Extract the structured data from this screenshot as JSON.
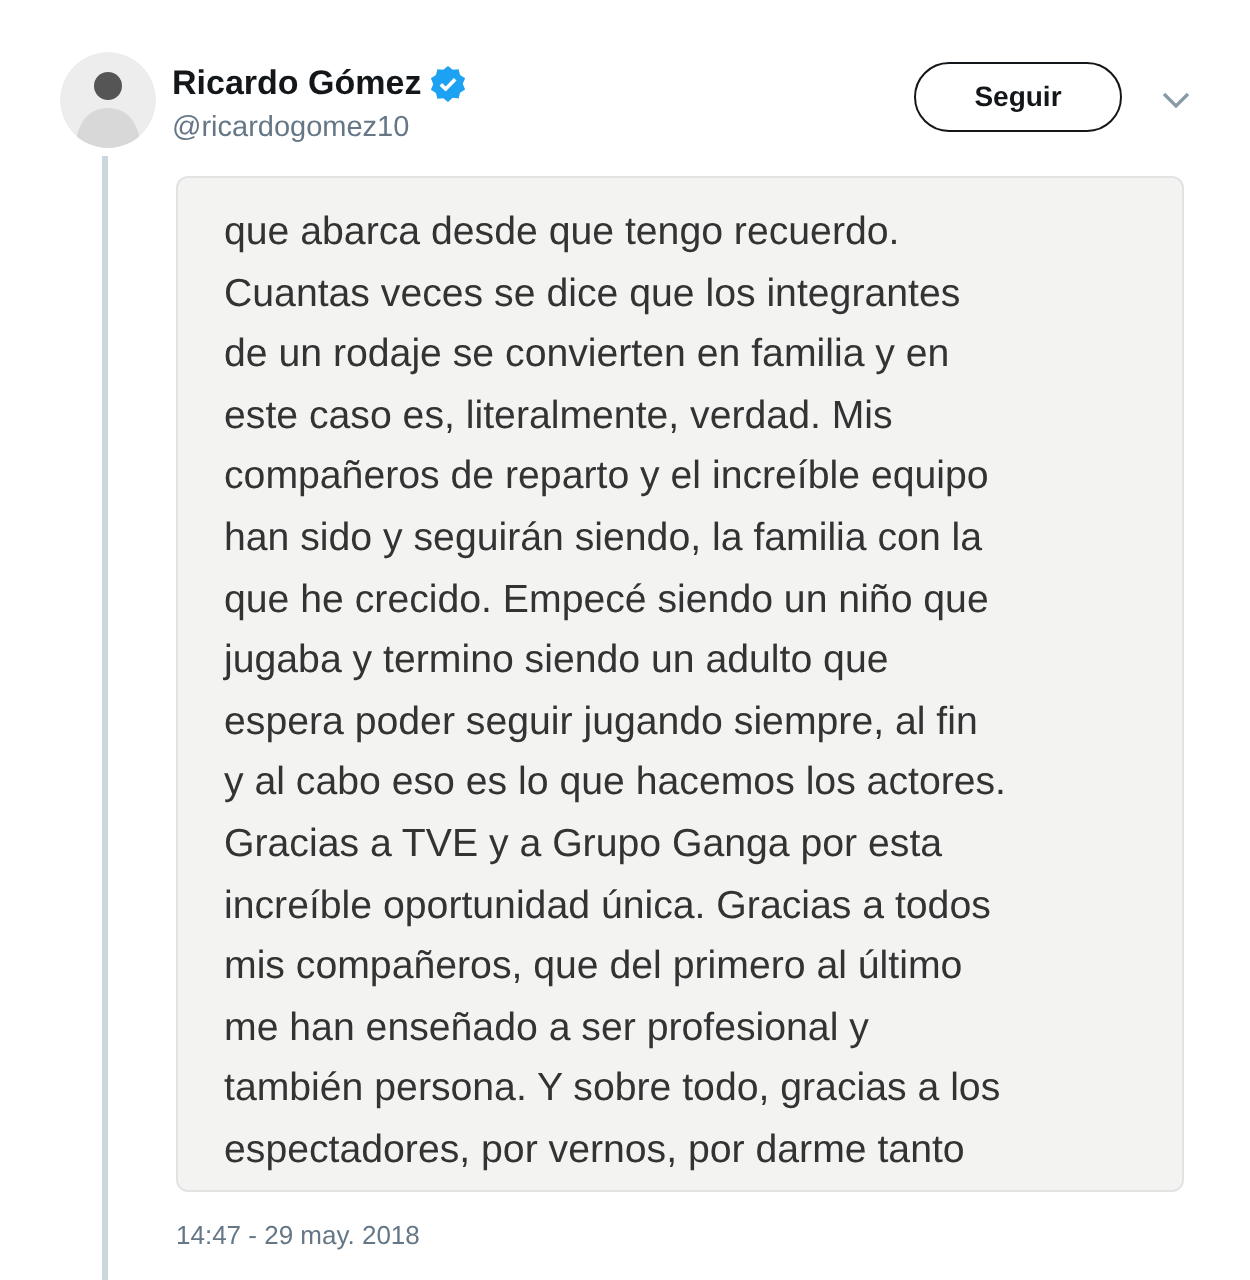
{
  "author": {
    "name": "Ricardo Gómez",
    "verified": true,
    "handle": "@ricardogomez10"
  },
  "follow_button": "Seguir",
  "image_text_lines": [
    "que abarca desde que tengo recuerdo.",
    "Cuantas veces se dice que los integrantes",
    "de un rodaje se convierten en familia y en",
    "este caso es, literalmente, verdad. Mis",
    "compañeros de reparto y el increíble equipo",
    "han sido y seguirán siendo, la familia con la",
    "que he crecido. Empecé siendo un niño que",
    "jugaba y termino siendo un adulto que",
    "espera poder seguir jugando siempre, al fin",
    "y al cabo eso es lo que hacemos los actores.",
    "Gracias a TVE y a Grupo Ganga por esta",
    "increíble oportunidad única. Gracias a todos",
    "mis compañeros, que del primero al último",
    "me han enseñado a ser profesional y",
    "también persona. Y sobre todo, gracias a los",
    "espectadores, por vernos, por darme tanto"
  ],
  "timestamp": "14:47 - 29 may. 2018"
}
